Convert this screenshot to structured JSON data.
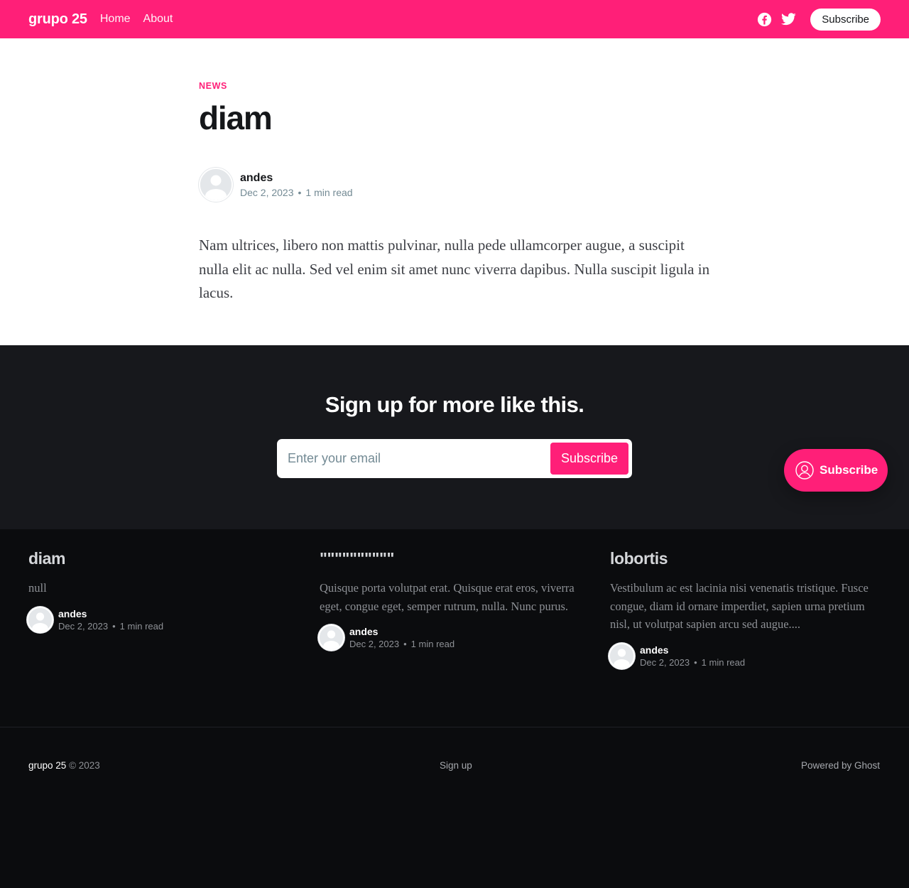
{
  "colors": {
    "accent": "#ff1f78",
    "dark": "#17181c",
    "darker": "#0b0c0e"
  },
  "header": {
    "site_title": "grupo 25",
    "nav": [
      {
        "label": "Home"
      },
      {
        "label": "About"
      }
    ],
    "icons": [
      "facebook-icon",
      "twitter-icon"
    ],
    "subscribe_label": "Subscribe"
  },
  "article": {
    "tag": "News",
    "title": "diam",
    "author": "andes",
    "date": "Dec 2, 2023",
    "read_time": "1 min read",
    "separator": "•",
    "body": "Nam ultrices, libero non mattis pulvinar, nulla pede ullamcorper augue, a suscipit nulla elit ac nulla. Sed vel enim sit amet nunc viverra dapibus. Nulla suscipit ligula in lacus."
  },
  "cta": {
    "title": "Sign up for more like this.",
    "email_placeholder": "Enter your email",
    "button_label": "Subscribe"
  },
  "floating_button": {
    "label": "Subscribe",
    "icon": "user-icon"
  },
  "related": [
    {
      "title": "diam",
      "excerpt": "null",
      "author": "andes",
      "date": "Dec 2, 2023",
      "read_time": "1 min read"
    },
    {
      "title": "\"\"\"\"\"\"\"\"\"\"",
      "excerpt": "Quisque porta volutpat erat. Quisque erat eros, viverra eget, congue eget, semper rutrum, nulla. Nunc purus.",
      "author": "andes",
      "date": "Dec 2, 2023",
      "read_time": "1 min read"
    },
    {
      "title": "lobortis",
      "excerpt": "Vestibulum ac est lacinia nisi venenatis tristique. Fusce congue, diam id ornare imperdiet, sapien urna pretium nisl, ut volutpat sapien arcu sed augue....",
      "author": "andes",
      "date": "Dec 2, 2023",
      "read_time": "1 min read"
    }
  ],
  "footer": {
    "site": "grupo 25",
    "copyright": "© 2023",
    "signup_label": "Sign up",
    "powered_by": "Powered by Ghost"
  }
}
